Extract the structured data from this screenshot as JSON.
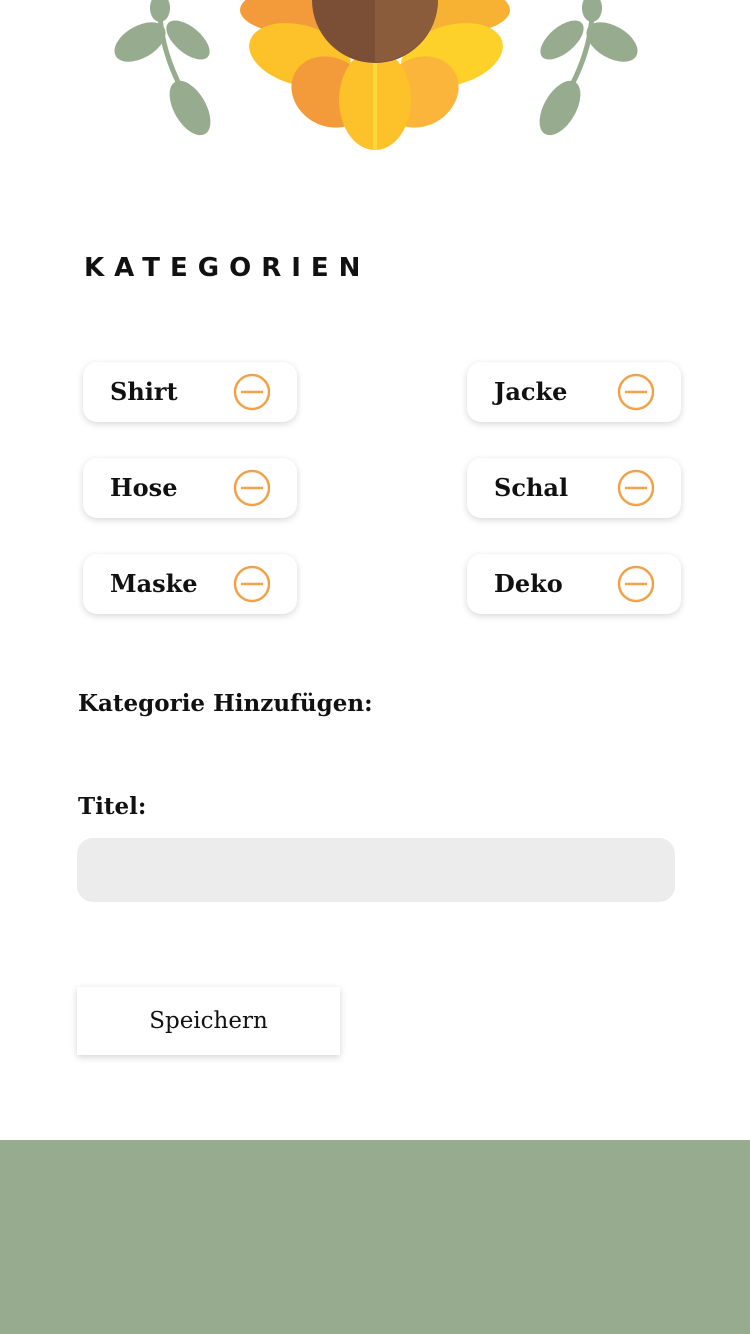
{
  "colors": {
    "accent_orange": "#f2a24a",
    "footer_green": "#97ab8e",
    "input_background": "#ececec",
    "leaf_green": "#97ab8e",
    "petal_yellow": "#fdd02a",
    "petal_orange": "#f39b3a",
    "flower_center_brown": "#8a5a3a"
  },
  "header": {
    "illustration": "sunflower-with-leaves"
  },
  "categories": {
    "title": "KATEGORIEN",
    "remove_icon": "minus-circle-icon",
    "items": [
      {
        "label": "Shirt"
      },
      {
        "label": "Jacke"
      },
      {
        "label": "Hose"
      },
      {
        "label": "Schal"
      },
      {
        "label": "Maske"
      },
      {
        "label": "Deko"
      }
    ]
  },
  "add_form": {
    "heading": "Kategorie Hinzufügen:",
    "title_label": "Titel:",
    "title_value": "",
    "title_placeholder": "",
    "save_label": "Speichern"
  }
}
